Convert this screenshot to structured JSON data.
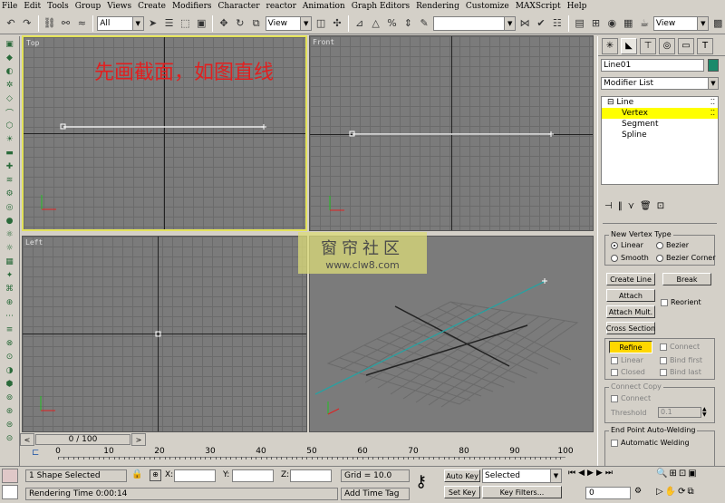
{
  "menu": [
    "File",
    "Edit",
    "Tools",
    "Group",
    "Views",
    "Create",
    "Modifiers",
    "Character",
    "reactor",
    "Animation",
    "Graph Editors",
    "Rendering",
    "Customize",
    "MAXScript",
    "Help"
  ],
  "toolbar": {
    "selection_filter": "All",
    "ref_coord": "View",
    "named_selection": "",
    "view_dropdown": "View"
  },
  "viewports": {
    "top": "Top",
    "front": "Front",
    "left": "Left",
    "perspective": ""
  },
  "annotation": "先画截面，如图直线",
  "watermark": {
    "title": "窗帘社区",
    "url": "www.clw8.com"
  },
  "command_panel": {
    "object_name": "Line01",
    "object_color": "#1b8a6b",
    "modifier_list": "Modifier List",
    "stack": [
      {
        "label": "Line",
        "prefix": "⊟"
      },
      {
        "label": "Vertex",
        "prefix": "",
        "selected": true
      },
      {
        "label": "Segment",
        "prefix": ""
      },
      {
        "label": "Spline",
        "prefix": ""
      }
    ],
    "new_vertex_type": {
      "title": "New Vertex Type",
      "linear": "Linear",
      "bezier": "Bezier",
      "smooth": "Smooth",
      "bezier_corner": "Bezier Corner"
    },
    "buttons": {
      "create_line": "Create Line",
      "break": "Break",
      "attach": "Attach",
      "reorient": "Reorient",
      "attach_mult": "Attach Mult.",
      "cross_section": "Cross Section",
      "refine": "Refine",
      "connect": "Connect",
      "linear": "Linear",
      "bind_first": "Bind first",
      "closed": "Closed",
      "bind_last": "Bind last"
    },
    "connect_copy": {
      "title": "Connect Copy",
      "connect": "Connect",
      "threshold_label": "Threshold",
      "threshold_value": "0.1"
    },
    "end_point": {
      "title": "End Point Auto-Welding",
      "automatic": "Automatic Welding"
    }
  },
  "timeline": {
    "frame": "0 / 100",
    "ticks": [
      "0",
      "10",
      "20",
      "30",
      "40",
      "50",
      "60",
      "70",
      "80",
      "90",
      "100"
    ]
  },
  "status": {
    "selected": "1 Shape Selected",
    "render_time": "Rendering Time  0:00:14",
    "x_label": "X:",
    "y_label": "Y:",
    "z_label": "Z:",
    "grid": "Grid = 10.0",
    "add_time_tag": "Add Time Tag",
    "auto_key": "Auto Key",
    "set_key": "Set Key",
    "selected_mode": "Selected",
    "key_filters": "Key Filters...",
    "frame_field": "0"
  }
}
